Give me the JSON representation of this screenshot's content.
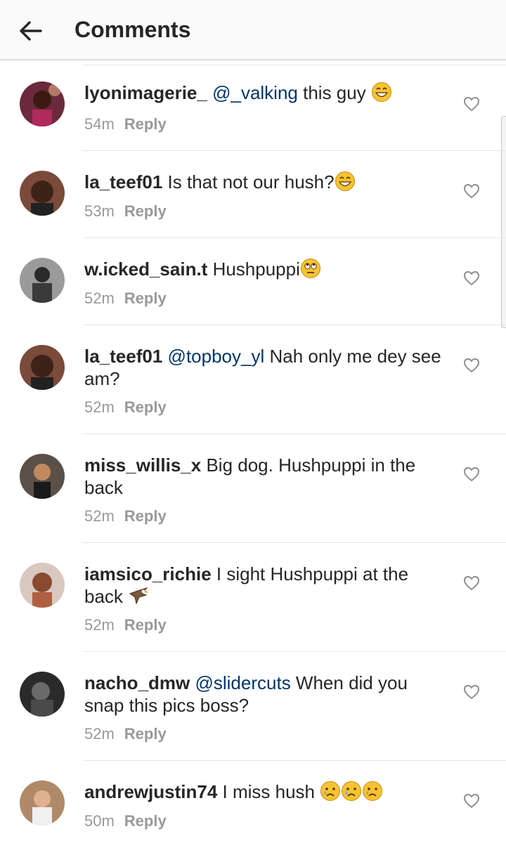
{
  "header": {
    "title": "Comments"
  },
  "comments": [
    {
      "username": "lyonimagerie_",
      "mention": "@_valking",
      "text": " this guy",
      "emoji": [
        "grin"
      ],
      "time": "54m",
      "reply": "Reply"
    },
    {
      "username": "la_teef01",
      "mention": "",
      "text": " Is that not our hush?",
      "emoji": [
        "grin"
      ],
      "time": "53m",
      "reply": "Reply"
    },
    {
      "username": "w.icked_sain.t",
      "mention": "",
      "text": " Hushpuppi",
      "emoji": [
        "eyeroll"
      ],
      "time": "52m",
      "reply": "Reply"
    },
    {
      "username": "la_teef01",
      "mention": "@topboy_yl",
      "text": " Nah only me dey see am?",
      "emoji": [],
      "time": "52m",
      "reply": "Reply"
    },
    {
      "username": "miss_willis_x",
      "mention": "",
      "text": " Big dog. Hushpuppi in the back",
      "emoji": [],
      "time": "52m",
      "reply": "Reply"
    },
    {
      "username": "iamsico_richie",
      "mention": "",
      "text": " I sight Hushpuppi at the back",
      "emoji": [
        "eagle"
      ],
      "time": "52m",
      "reply": "Reply"
    },
    {
      "username": "nacho_dmw",
      "mention": "@slidercuts",
      "text": " When did you snap this pics boss?",
      "emoji": [],
      "time": "52m",
      "reply": "Reply"
    },
    {
      "username": "andrewjustin74",
      "mention": "",
      "text": " I miss hush",
      "emoji": [
        "cry",
        "cry",
        "cry"
      ],
      "time": "50m",
      "reply": "Reply"
    }
  ],
  "colors": {
    "mention": "#003569",
    "meta": "#999999",
    "text": "#262626"
  },
  "icons": {
    "back": "arrow-left-icon",
    "like": "heart-outline-icon"
  }
}
